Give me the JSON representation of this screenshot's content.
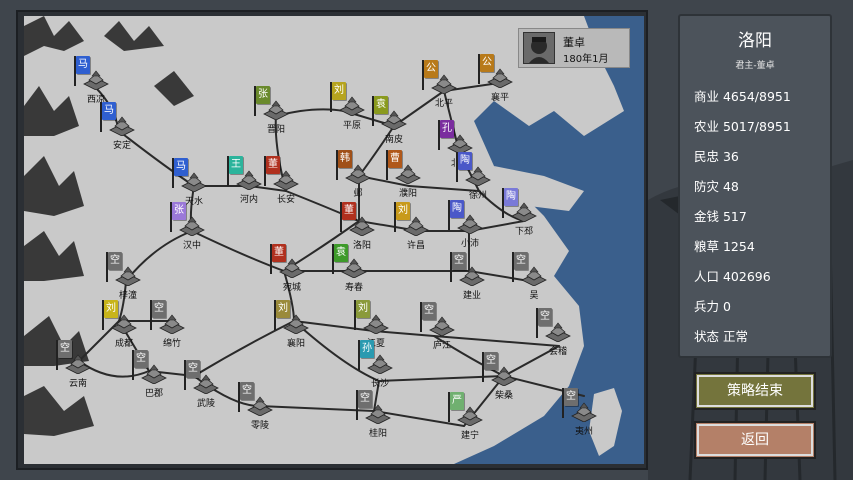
{
  "leader": {
    "name": "董卓",
    "date": "180年1月"
  },
  "city_panel": {
    "title": "洛阳",
    "ruler": "君主-董卓",
    "stats": [
      "商业 4654/8951",
      "农业 5017/8951",
      "民忠 36",
      "防灾 48",
      "金钱 517",
      "粮草 1254",
      "人口 402696",
      "兵力 0",
      "状态 正常"
    ]
  },
  "buttons": {
    "end_strategy": "策略结束",
    "back": "返回"
  },
  "colors": {
    "sea": "#3a5f8c",
    "land": "#c8c8c8",
    "road": "#2a2a2a",
    "ma": "#2f5fd0",
    "zhang": "#6a8a2c",
    "liu": "#b6a41e",
    "yuan": "#7a8f1a",
    "gongsun": "#b87a1a",
    "kong": "#7a2d9e",
    "wang": "#2cb49c",
    "dong": "#b0301e",
    "han": "#a05018",
    "cao": "#b0581a",
    "tao": "#4a58c8",
    "zhangnorth": "#7a7ad8",
    "kong_empty": "#6e6e6e",
    "sun": "#2a9ab0",
    "yan": "#3e9a2a",
    "yanbai": "#70b070"
  },
  "cities": [
    {
      "name": "西凉",
      "flag": "马",
      "color": "#2f5fd0"
    },
    {
      "name": "安定",
      "flag": "马",
      "color": "#2f5fd0"
    },
    {
      "name": "天水",
      "flag": "马",
      "color": "#2f5fd0"
    },
    {
      "name": "河内",
      "flag": "王",
      "color": "#2cb49c"
    },
    {
      "name": "长安",
      "flag": "董",
      "color": "#b0301e"
    },
    {
      "name": "晋阳",
      "flag": "张",
      "color": "#6a8a2c"
    },
    {
      "name": "平原",
      "flag": "刘",
      "color": "#b6a41e"
    },
    {
      "name": "南皮",
      "flag": "袁",
      "color": "#8a9a1e"
    },
    {
      "name": "北平",
      "flag": "公",
      "color": "#b87a1a"
    },
    {
      "name": "襄平",
      "flag": "公",
      "color": "#b87a1a"
    },
    {
      "name": "北海",
      "flag": "孔",
      "color": "#7a2d9e"
    },
    {
      "name": "邺",
      "flag": "韩",
      "color": "#a05018"
    },
    {
      "name": "濮阳",
      "flag": "曹",
      "color": "#b0581a"
    },
    {
      "name": "徐州",
      "flag": "陶",
      "color": "#4a58c8"
    },
    {
      "name": "下邳",
      "flag": "陶",
      "color": "#7a7ad8"
    },
    {
      "name": "汉中",
      "flag": "张",
      "color": "#9a78d8"
    },
    {
      "name": "洛阳",
      "flag": "董",
      "color": "#b0301e"
    },
    {
      "name": "许昌",
      "flag": "刘",
      "color": "#c89a1a"
    },
    {
      "name": "小沛",
      "flag": "陶",
      "color": "#4a58c8"
    },
    {
      "name": "宛城",
      "flag": "董",
      "color": "#b0301e"
    },
    {
      "name": "寿春",
      "flag": "袁",
      "color": "#3e9a2a"
    },
    {
      "name": "建业",
      "flag": "空",
      "color": "#6e6e6e"
    },
    {
      "name": "吴",
      "flag": "空",
      "color": "#6e6e6e"
    },
    {
      "name": "梓潼",
      "flag": "空",
      "color": "#6e6e6e"
    },
    {
      "name": "成都",
      "flag": "刘",
      "color": "#c8b41a"
    },
    {
      "name": "绵竹",
      "flag": "空",
      "color": "#6e6e6e"
    },
    {
      "name": "襄阳",
      "flag": "刘",
      "color": "#9a8a3a"
    },
    {
      "name": "江夏",
      "flag": "刘",
      "color": "#8a9a3a"
    },
    {
      "name": "庐江",
      "flag": "空",
      "color": "#6e6e6e"
    },
    {
      "name": "会稽",
      "flag": "空",
      "color": "#6e6e6e"
    },
    {
      "name": "云南",
      "flag": "空",
      "color": "#6e6e6e"
    },
    {
      "name": "巴郡",
      "flag": "空",
      "color": "#6e6e6e"
    },
    {
      "name": "武陵",
      "flag": "空",
      "color": "#6e6e6e"
    },
    {
      "name": "长沙",
      "flag": "孙",
      "color": "#2a9ab0"
    },
    {
      "name": "柴桑",
      "flag": "空",
      "color": "#6e6e6e"
    },
    {
      "name": "零陵",
      "flag": "空",
      "color": "#6e6e6e"
    },
    {
      "name": "桂阳",
      "flag": "空",
      "color": "#6e6e6e"
    },
    {
      "name": "建宁",
      "flag": "严",
      "color": "#70b070"
    },
    {
      "name": "夷州",
      "flag": "空",
      "color": "#6e6e6e"
    }
  ]
}
